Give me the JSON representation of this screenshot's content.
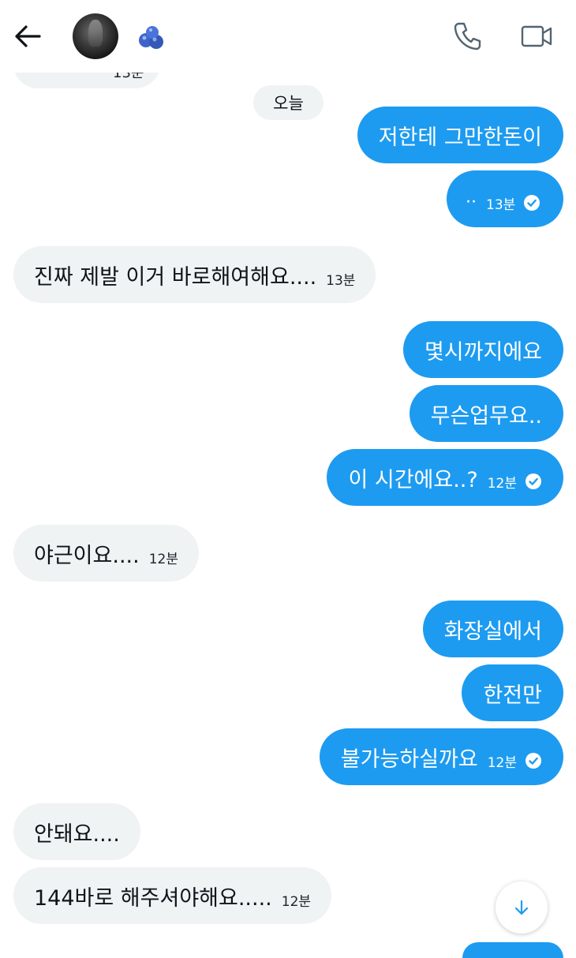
{
  "header": {
    "back_icon": "arrow-left-icon",
    "avatar_icon": "profile-avatar",
    "badge_icon": "blueberry-emoji",
    "call_icon": "phone-icon",
    "video_icon": "video-camera-icon"
  },
  "colors": {
    "outgoing_bubble": "#1d9bf0",
    "incoming_bubble": "#eff3f4",
    "background": "#ffffff"
  },
  "partial_message": {
    "time": "13분"
  },
  "day_separator": "오늘",
  "messages": [
    {
      "dir": "out",
      "text": "저한테 그만한돈이",
      "time": ""
    },
    {
      "dir": "out",
      "text": "··",
      "time": "13분",
      "read": true
    },
    {
      "dir": "in",
      "text": "진짜 제발 이거 바로해여해요....",
      "time": "13분"
    },
    {
      "dir": "out",
      "text": "몇시까지에요",
      "time": ""
    },
    {
      "dir": "out",
      "text": "무슨업무요..",
      "time": ""
    },
    {
      "dir": "out",
      "text": "이 시간에요..?",
      "time": "12분",
      "read": true
    },
    {
      "dir": "in",
      "text": "야근이요....",
      "time": "12분"
    },
    {
      "dir": "out",
      "text": "화장실에서",
      "time": ""
    },
    {
      "dir": "out",
      "text": "한전만",
      "time": ""
    },
    {
      "dir": "out",
      "text": "불가능하실까요",
      "time": "12분",
      "read": true
    },
    {
      "dir": "in",
      "text": "안돼요....",
      "time": ""
    },
    {
      "dir": "in",
      "text": "144바로 해주셔야해요.....",
      "time": "12분"
    }
  ],
  "scroll_button_icon": "arrow-down-icon"
}
